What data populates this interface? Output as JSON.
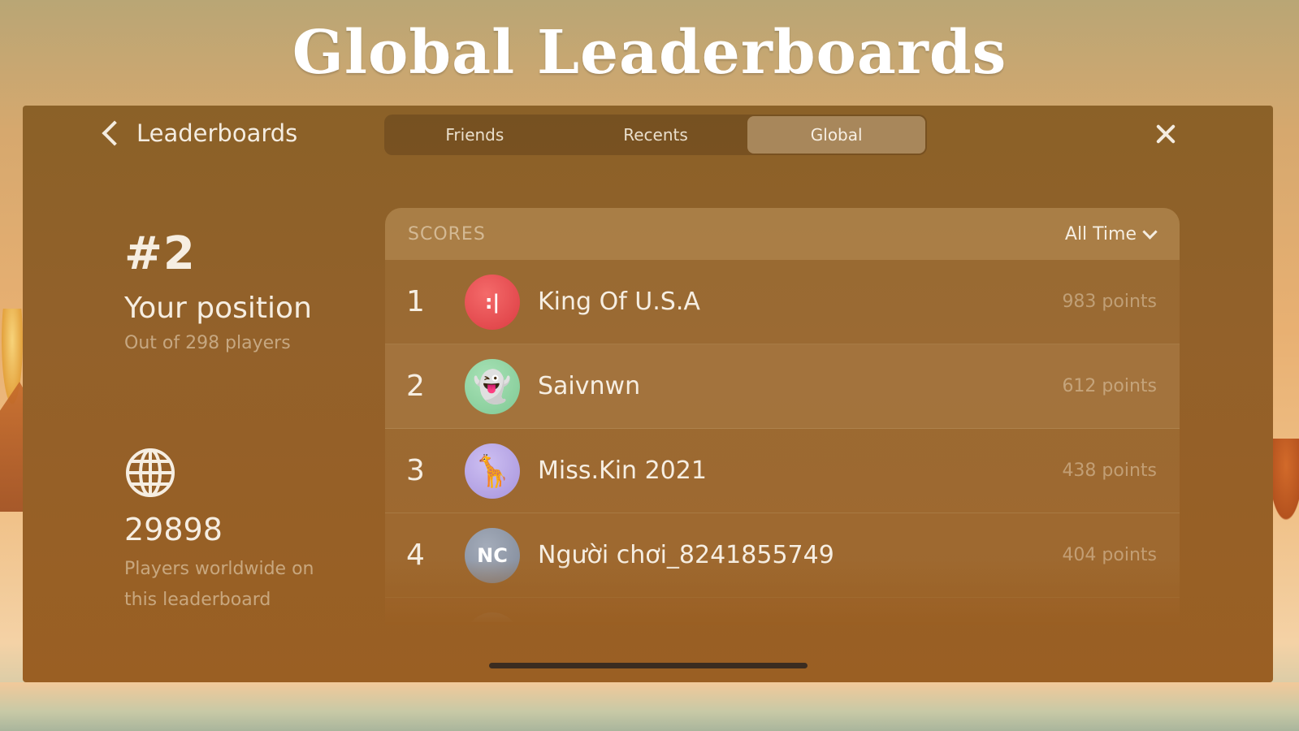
{
  "banner": {
    "title": "Global Leaderboards"
  },
  "nav": {
    "back_label": "Leaderboards"
  },
  "tabs": [
    {
      "label": "Friends",
      "active": false
    },
    {
      "label": "Recents",
      "active": false
    },
    {
      "label": "Global",
      "active": true
    }
  ],
  "summary": {
    "rank": "#2",
    "position_label": "Your position",
    "position_sub": "Out of 298 players",
    "players_count": "29898",
    "players_sub": "Players worldwide on this leaderboard"
  },
  "scores": {
    "header": "SCORES",
    "time_filter": "All Time",
    "rows": [
      {
        "rank": "1",
        "name": "King Of U.S.A",
        "points": "983 points",
        "avatar_text": ":|",
        "avatar_icon": "face-glyph",
        "avatar_color": "#e5474b"
      },
      {
        "rank": "2",
        "name": "Saivnwn",
        "points": "612 points",
        "avatar_text": "👻",
        "avatar_icon": "ghost-emoji",
        "avatar_color": "#8fd3a2"
      },
      {
        "rank": "3",
        "name": "Miss.Kin 2021",
        "points": "438 points",
        "avatar_text": "🦒",
        "avatar_icon": "giraffe-emoji",
        "avatar_color": "#b7a6e6"
      },
      {
        "rank": "4",
        "name": "Người chơi_8241855749",
        "points": "404 points",
        "avatar_text": "NC",
        "avatar_icon": "initials",
        "avatar_color": "#8e97a6"
      }
    ]
  },
  "colors": {
    "panel": "#93612a",
    "text": "#f6eee2",
    "active_tab": "#c4a581"
  }
}
